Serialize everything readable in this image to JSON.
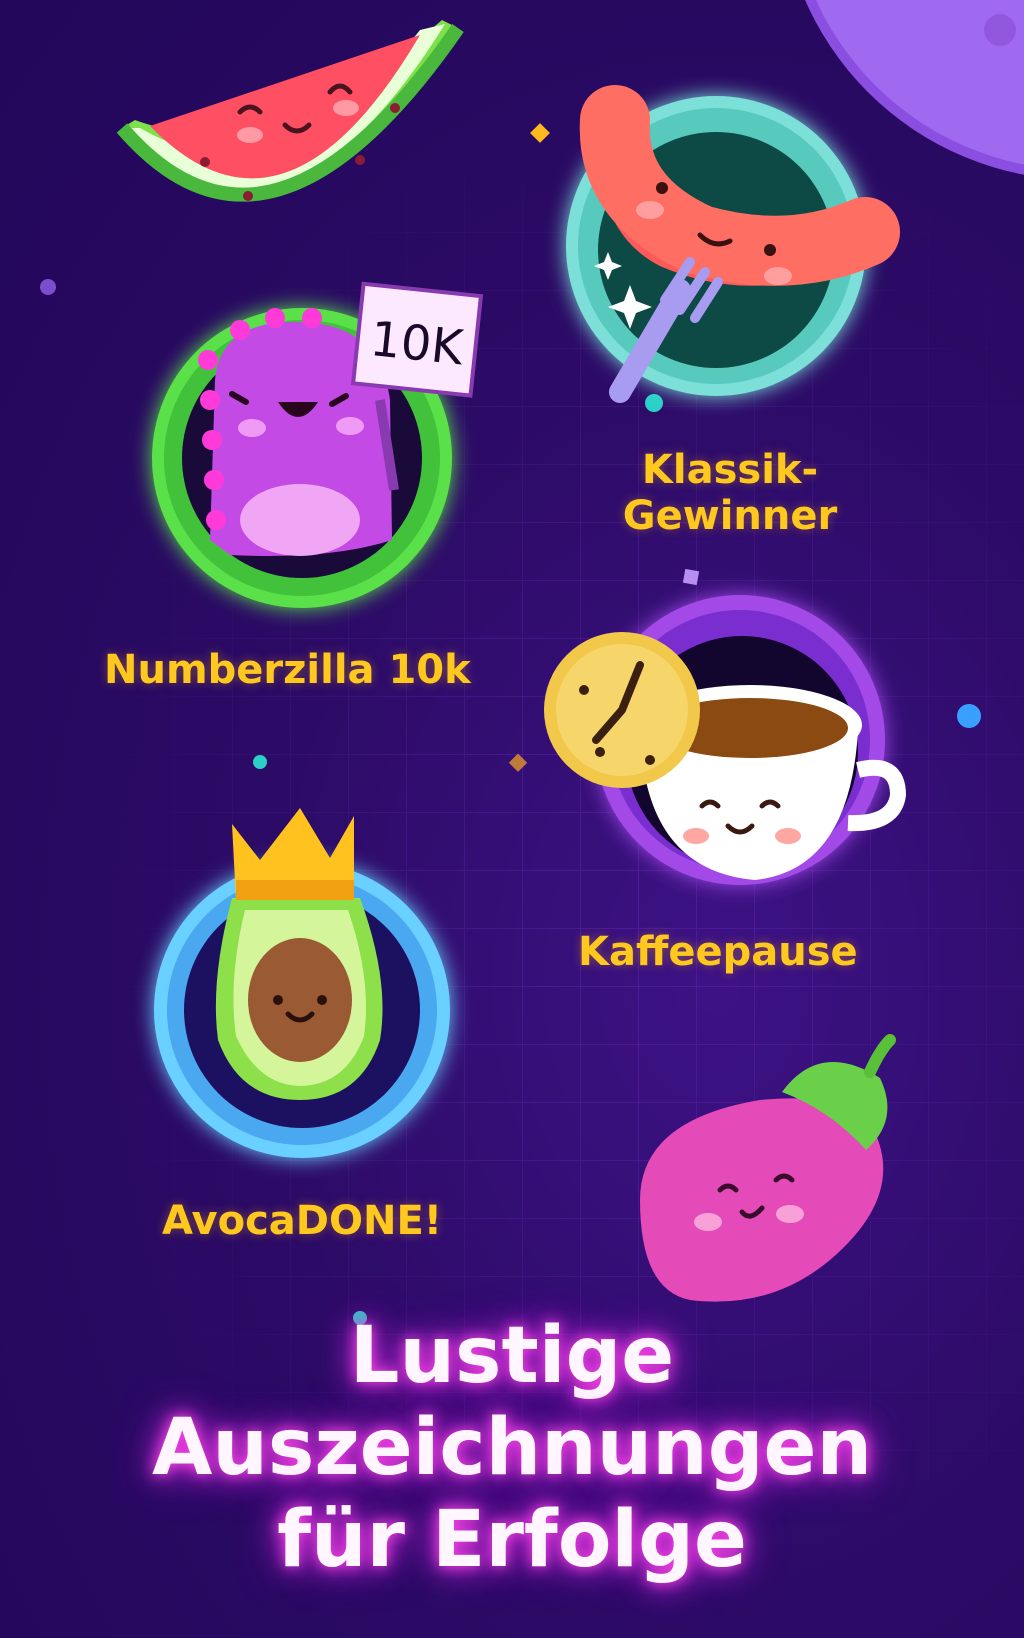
{
  "badges": [
    {
      "id": "klassik",
      "label_line1": "Klassik-",
      "label_line2": "Gewinner",
      "icon": "sausage-icon"
    },
    {
      "id": "numberzilla",
      "label": "Numberzilla 10k",
      "icon": "monster-icon",
      "sign_text": "10K"
    },
    {
      "id": "kaffee",
      "label": "Kaffeepause",
      "icon": "coffee-cup-icon"
    },
    {
      "id": "avoca",
      "label": "AvocaDONE!",
      "icon": "avocado-icon"
    }
  ],
  "decorations": [
    "watermelon-icon",
    "eggplant-icon",
    "planet-icon"
  ],
  "headline": {
    "line1": "Lustige",
    "line2": "Auszeichnungen",
    "line3": "für Erfolge"
  },
  "colors": {
    "background": "#2c0b66",
    "label": "#ffc81e",
    "headline_glow": "#ff48e8"
  }
}
